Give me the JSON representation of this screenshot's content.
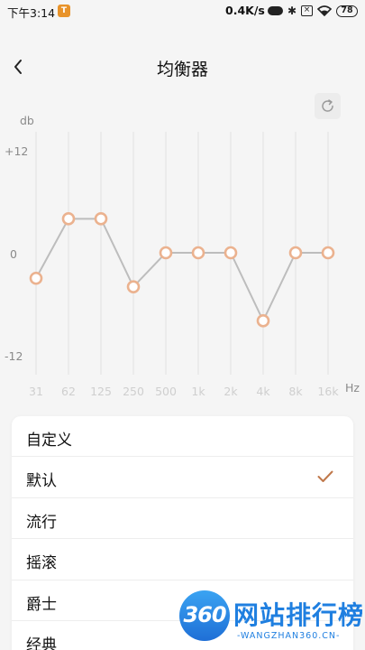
{
  "status_bar": {
    "time": "下午3:14",
    "speed": "0.4K/s",
    "battery": "78",
    "app_icon": "pill-icon"
  },
  "header": {
    "title": "均衡器",
    "back_icon": "chevron-left-icon",
    "reset_icon": "refresh-icon"
  },
  "chart_data": {
    "type": "line",
    "ylabel": "db",
    "xlabel": "Hz",
    "y_ticks": [
      "+12",
      "0",
      "-12"
    ],
    "ylim": [
      -12,
      12
    ],
    "categories": [
      "31",
      "62",
      "125",
      "250",
      "500",
      "1k",
      "2k",
      "4k",
      "8k",
      "16k"
    ],
    "values": [
      -3,
      4,
      4,
      -4,
      0,
      0,
      0,
      -8,
      0,
      0
    ],
    "grid": "vertical",
    "line_color": "#bdbdbd",
    "point_color": "#ebb28f"
  },
  "presets": [
    {
      "label": "自定义",
      "selected": false
    },
    {
      "label": "默认",
      "selected": true
    },
    {
      "label": "流行",
      "selected": false
    },
    {
      "label": "摇滚",
      "selected": false
    },
    {
      "label": "爵士",
      "selected": false
    },
    {
      "label": "经典",
      "selected": false
    }
  ],
  "accent_color": "#c0784a",
  "watermark": {
    "badge": "360",
    "name": "网站排行榜",
    "url": "-WANGZHAN360.CN-"
  }
}
